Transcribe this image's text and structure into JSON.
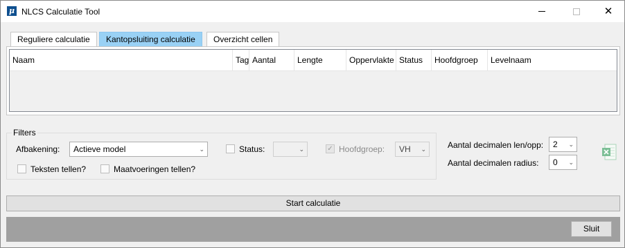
{
  "window": {
    "title": "NLCS Calculatie Tool",
    "icon_glyph": "μ",
    "close_glyph": "✕"
  },
  "tabs": [
    {
      "label": "Reguliere calculatie",
      "active": false
    },
    {
      "label": "Kantopsluiting calculatie",
      "active": true
    },
    {
      "label": "Overzicht cellen",
      "active": false
    }
  ],
  "grid": {
    "columns": [
      "Naam",
      "Tags",
      "Aantal",
      "Lengte",
      "Oppervlakte",
      "Status",
      "Hoofdgroep",
      "Levelnaam"
    ],
    "rows": []
  },
  "filters": {
    "legend": "Filters",
    "afbakening_label": "Afbakening:",
    "afbakening_value": "Actieve model",
    "status_label": "Status:",
    "status_value": "",
    "status_checked": false,
    "hoofdgroep_label": "Hoofdgroep:",
    "hoofdgroep_value": "VH",
    "hoofdgroep_checked": true,
    "teksten_label": "Teksten tellen?",
    "teksten_checked": false,
    "maatvoeringen_label": "Maatvoeringen tellen?",
    "maatvoeringen_checked": false
  },
  "decimals": {
    "len_opp_label": "Aantal decimalen len/opp:",
    "len_opp_value": "2",
    "radius_label": "Aantal decimalen radius:",
    "radius_value": "0"
  },
  "icons": {
    "excel_export": "excel-icon",
    "dropdown": "chevron-down-icon",
    "check": "✓",
    "chevron": "⌄"
  },
  "colors": {
    "active_tab": "#99d1f5",
    "footer_bar": "#a0a0a0",
    "excel_green": "#7cbf96"
  },
  "actions": {
    "start_label": "Start calculatie",
    "close_label": "Sluit"
  }
}
